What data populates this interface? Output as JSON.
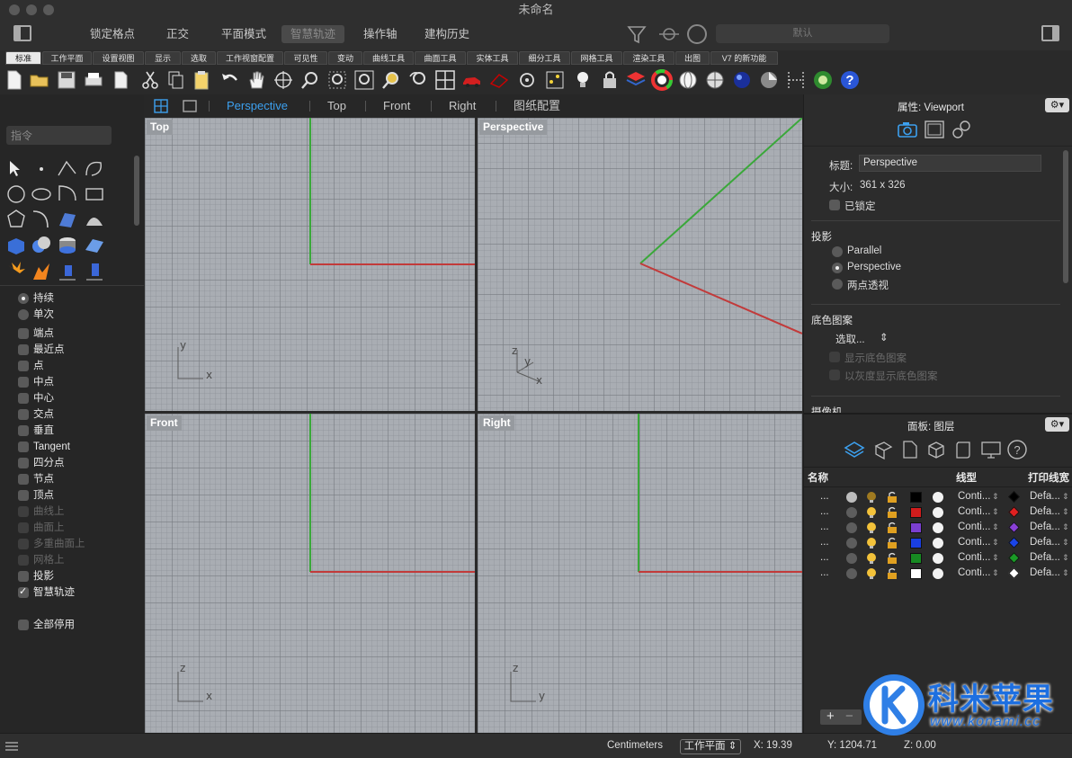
{
  "window": {
    "title": "未命名"
  },
  "topbar": {
    "items": [
      "锁定格点",
      "正交",
      "平面模式",
      "智慧轨迹",
      "操作轴",
      "建构历史"
    ],
    "active_item": "智慧轨迹",
    "layer_select": "默认"
  },
  "tabs": [
    "标准",
    "工作平面",
    "设置视图",
    "显示",
    "选取",
    "工作视窗配置",
    "可见性",
    "变动",
    "曲线工具",
    "曲面工具",
    "实体工具",
    "细分工具",
    "网格工具",
    "渲染工具",
    "出图",
    "V7 的新功能"
  ],
  "active_tab": "标准",
  "command": {
    "placeholder": "指令"
  },
  "osnap": {
    "modes": [
      {
        "label": "持续",
        "type": "radio",
        "checked": true
      },
      {
        "label": "单次",
        "type": "radio",
        "checked": false
      }
    ],
    "items": [
      {
        "label": "端点",
        "checked": false,
        "enabled": true
      },
      {
        "label": "最近点",
        "checked": false,
        "enabled": true
      },
      {
        "label": "点",
        "checked": false,
        "enabled": true
      },
      {
        "label": "中点",
        "checked": false,
        "enabled": true
      },
      {
        "label": "中心",
        "checked": false,
        "enabled": true
      },
      {
        "label": "交点",
        "checked": false,
        "enabled": true
      },
      {
        "label": "垂直",
        "checked": false,
        "enabled": true
      },
      {
        "label": "Tangent",
        "checked": false,
        "enabled": true
      },
      {
        "label": "四分点",
        "checked": false,
        "enabled": true
      },
      {
        "label": "节点",
        "checked": false,
        "enabled": true
      },
      {
        "label": "顶点",
        "checked": false,
        "enabled": true
      },
      {
        "label": "曲线上",
        "checked": false,
        "enabled": false
      },
      {
        "label": "曲面上",
        "checked": false,
        "enabled": false
      },
      {
        "label": "多重曲面上",
        "checked": false,
        "enabled": false
      },
      {
        "label": "网格上",
        "checked": false,
        "enabled": false
      },
      {
        "label": "投影",
        "checked": false,
        "enabled": true
      },
      {
        "label": "智慧轨迹",
        "checked": true,
        "enabled": true
      }
    ],
    "disable_all": "全部停用"
  },
  "viewport_tabs": [
    "Perspective",
    "Top",
    "Front",
    "Right",
    "图纸配置"
  ],
  "active_viewport_tab": "Perspective",
  "viewports": {
    "top": {
      "label": "Top",
      "axis1": "y",
      "axis2": "x"
    },
    "perspective": {
      "label": "Perspective",
      "axis1": "z",
      "axis2": "y",
      "axis3": "x"
    },
    "front": {
      "label": "Front",
      "axis1": "z",
      "axis2": "x"
    },
    "right": {
      "label": "Right",
      "axis1": "z",
      "axis2": "y"
    }
  },
  "properties": {
    "title": "属性: Viewport",
    "name_label": "标题:",
    "name_value": "Perspective",
    "size_label": "大小:",
    "size_value": "361 x 326",
    "locked_label": "已锁定",
    "projection_title": "投影",
    "projection_options": [
      "Parallel",
      "Perspective",
      "两点透视"
    ],
    "projection_selected": "Perspective",
    "wallpaper_title": "底色图案",
    "wallpaper_select": "选取...",
    "wallpaper_show": "显示底色图案",
    "wallpaper_gray": "以灰度显示底色图案",
    "camera_title": "摄像机"
  },
  "layers_panel": {
    "title": "面板: 图层",
    "col_name": "名称",
    "col_linetype": "线型",
    "col_printwidth": "打印线宽",
    "rows": [
      {
        "name": "...",
        "color": "#000000",
        "linetype": "Conti...",
        "printcolor": "#000000",
        "printwidth": "Defa...",
        "current": true
      },
      {
        "name": "...",
        "color": "#d01c1c",
        "linetype": "Conti...",
        "printcolor": "#e02020",
        "printwidth": "Defa...",
        "current": false
      },
      {
        "name": "...",
        "color": "#7b3fd0",
        "linetype": "Conti...",
        "printcolor": "#8a40d8",
        "printwidth": "Defa...",
        "current": false
      },
      {
        "name": "...",
        "color": "#1a3fe0",
        "linetype": "Conti...",
        "printcolor": "#1a44e8",
        "printwidth": "Defa...",
        "current": false
      },
      {
        "name": "...",
        "color": "#178a22",
        "linetype": "Conti...",
        "printcolor": "#1a9a26",
        "printwidth": "Defa...",
        "current": false
      },
      {
        "name": "...",
        "color": "#ffffff",
        "linetype": "Conti...",
        "printcolor": "#ffffff",
        "printwidth": "Defa...",
        "current": false
      }
    ],
    "add_label": "+",
    "remove_label": "−"
  },
  "status": {
    "units": "Centimeters",
    "cplane": "工作平面",
    "x": "X: 19.39",
    "y": "Y: 1204.71",
    "z": "Z: 0.00"
  },
  "watermark": {
    "brand": "科米苹果",
    "url": "www.konami.cc"
  }
}
